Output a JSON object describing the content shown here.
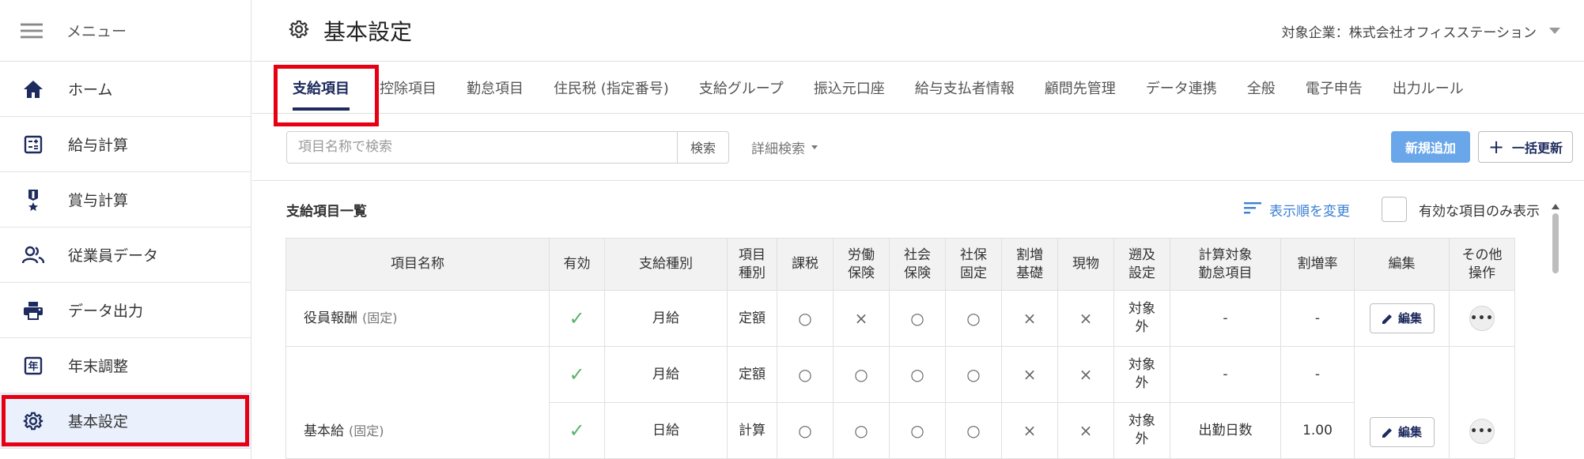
{
  "sidebar": {
    "menu_label": "メニュー",
    "items": [
      {
        "label": "ホーム",
        "icon": "home-icon"
      },
      {
        "label": "給与計算",
        "icon": "calculator-icon"
      },
      {
        "label": "賞与計算",
        "icon": "medal-icon"
      },
      {
        "label": "従業員データ",
        "icon": "people-icon"
      },
      {
        "label": "データ出力",
        "icon": "printer-icon"
      },
      {
        "label": "年末調整",
        "icon": "year-icon"
      },
      {
        "label": "基本設定",
        "icon": "gear-icon",
        "active": true
      }
    ]
  },
  "header": {
    "title": "基本設定",
    "company_label": "対象企業：株式会社オフィスステーション"
  },
  "tabs": [
    "支給項目",
    "控除項目",
    "勤怠項目",
    "住民税 (指定番号)",
    "支給グループ",
    "振込元口座",
    "給与支払者情報",
    "顧問先管理",
    "データ連携",
    "全般",
    "電子申告",
    "出力ルール"
  ],
  "active_tab": "支給項目",
  "search": {
    "placeholder": "項目名称で検索",
    "button": "検索",
    "advanced": "詳細検索"
  },
  "actions": {
    "new": "新規追加",
    "bulk": "一括更新"
  },
  "list": {
    "title": "支給項目一覧",
    "sort_link": "表示順を変更",
    "only_valid": "有効な項目のみ表示"
  },
  "table": {
    "headers": [
      "項目名称",
      "有効",
      "支給種別",
      "項目\n種別",
      "課税",
      "労働\n保険",
      "社会\n保険",
      "社保\n固定",
      "割増\n基礎",
      "現物",
      "遡及\n設定",
      "計算対象\n勤怠項目",
      "割増率",
      "編集",
      "その他\n操作"
    ],
    "rows": [
      {
        "name": "役員報酬",
        "name_suffix": "(固定)",
        "valid": "✓",
        "pay_type": "月給",
        "item_type": "定額",
        "tax": "○",
        "labor": "×",
        "social": "○",
        "social_fixed": "○",
        "premium_base": "×",
        "in_kind": "×",
        "retro": "対象\n外",
        "attendance": "-",
        "rate": "-",
        "edit": "編集",
        "more": "•••"
      },
      {
        "name": "基本給",
        "name_suffix": "(固定)",
        "valid": "✓",
        "pay_type": "月給",
        "item_type": "定額",
        "tax": "○",
        "labor": "○",
        "social": "○",
        "social_fixed": "○",
        "premium_base": "×",
        "in_kind": "×",
        "retro": "対象\n外",
        "attendance": "-",
        "rate": "-",
        "edit": "編集",
        "more": "•••"
      },
      {
        "valid": "✓",
        "pay_type": "日給",
        "item_type": "計算",
        "tax": "○",
        "labor": "○",
        "social": "○",
        "social_fixed": "○",
        "premium_base": "×",
        "in_kind": "×",
        "retro": "対象\n外",
        "attendance": "出勤日数",
        "rate": "1.00"
      }
    ]
  },
  "colors": {
    "primary": "#1d2b5e",
    "accent_blue": "#6aa6ea",
    "link": "#3a7fd5",
    "check_green": "#58b368",
    "highlight_red": "#e60012",
    "active_bg": "#eaf1fd"
  }
}
